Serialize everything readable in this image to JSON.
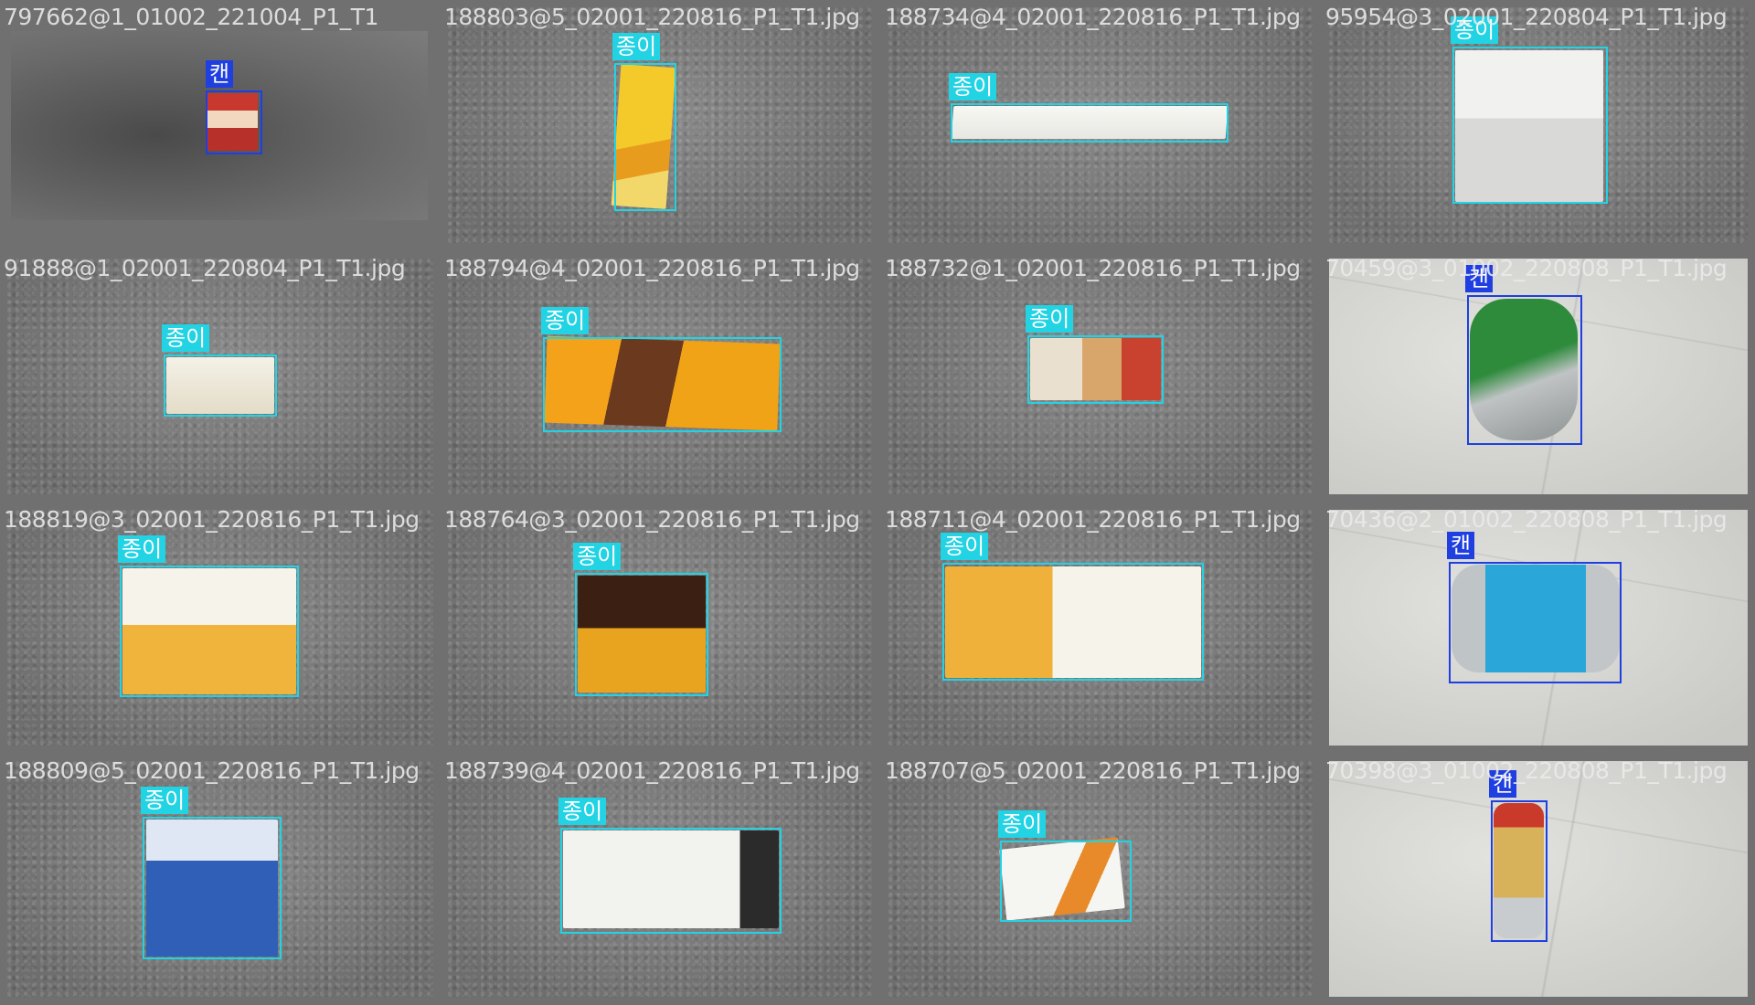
{
  "colors": {
    "paper": "#22d3e4",
    "can": "#1f3fe0"
  },
  "classes": {
    "paper_label": "종이",
    "can_label": "캔"
  },
  "cells": [
    {
      "row": 0,
      "col": 0,
      "filename": "797662@1_01002_221004_P1_T1",
      "label": "캔",
      "cls": "can",
      "bg": "dark"
    },
    {
      "row": 0,
      "col": 1,
      "filename": "188803@5_02001_220816_P1_T1.jpg",
      "label": "종이",
      "cls": "paper",
      "bg": "asphalt"
    },
    {
      "row": 0,
      "col": 2,
      "filename": "188734@4_02001_220816_P1_T1.jpg",
      "label": "종이",
      "cls": "paper",
      "bg": "asphalt"
    },
    {
      "row": 0,
      "col": 3,
      "filename": "95954@3_02001_220804_P1_T1.jpg",
      "label": "종이",
      "cls": "paper",
      "bg": "asphalt"
    },
    {
      "row": 1,
      "col": 0,
      "filename": "91888@1_02001_220804_P1_T1.jpg",
      "label": "종이",
      "cls": "paper",
      "bg": "asphalt"
    },
    {
      "row": 1,
      "col": 1,
      "filename": "188794@4_02001_220816_P1_T1.jpg",
      "label": "종이",
      "cls": "paper",
      "bg": "asphalt"
    },
    {
      "row": 1,
      "col": 2,
      "filename": "188732@1_02001_220816_P1_T1.jpg",
      "label": "종이",
      "cls": "paper",
      "bg": "asphalt"
    },
    {
      "row": 1,
      "col": 3,
      "filename": "70459@3_01002_220808_P1_T1.jpg",
      "label": "캔",
      "cls": "can",
      "bg": "tile"
    },
    {
      "row": 2,
      "col": 0,
      "filename": "188819@3_02001_220816_P1_T1.jpg",
      "label": "종이",
      "cls": "paper",
      "bg": "asphalt"
    },
    {
      "row": 2,
      "col": 1,
      "filename": "188764@3_02001_220816_P1_T1.jpg",
      "label": "종이",
      "cls": "paper",
      "bg": "asphalt"
    },
    {
      "row": 2,
      "col": 2,
      "filename": "188711@4_02001_220816_P1_T1.jpg",
      "label": "종이",
      "cls": "paper",
      "bg": "asphalt"
    },
    {
      "row": 2,
      "col": 3,
      "filename": "70436@2_01002_220808_P1_T1.jpg",
      "label": "캔",
      "cls": "can",
      "bg": "tile"
    },
    {
      "row": 3,
      "col": 0,
      "filename": "188809@5_02001_220816_P1_T1.jpg",
      "label": "종이",
      "cls": "paper",
      "bg": "asphalt"
    },
    {
      "row": 3,
      "col": 1,
      "filename": "188739@4_02001_220816_P1_T1.jpg",
      "label": "종이",
      "cls": "paper",
      "bg": "asphalt"
    },
    {
      "row": 3,
      "col": 2,
      "filename": "188707@5_02001_220816_P1_T1.jpg",
      "label": "종이",
      "cls": "paper",
      "bg": "asphalt"
    },
    {
      "row": 3,
      "col": 3,
      "filename": "70398@3_01002_220808_P1_T1.jpg",
      "label": "캔",
      "cls": "can",
      "bg": "tile"
    }
  ]
}
